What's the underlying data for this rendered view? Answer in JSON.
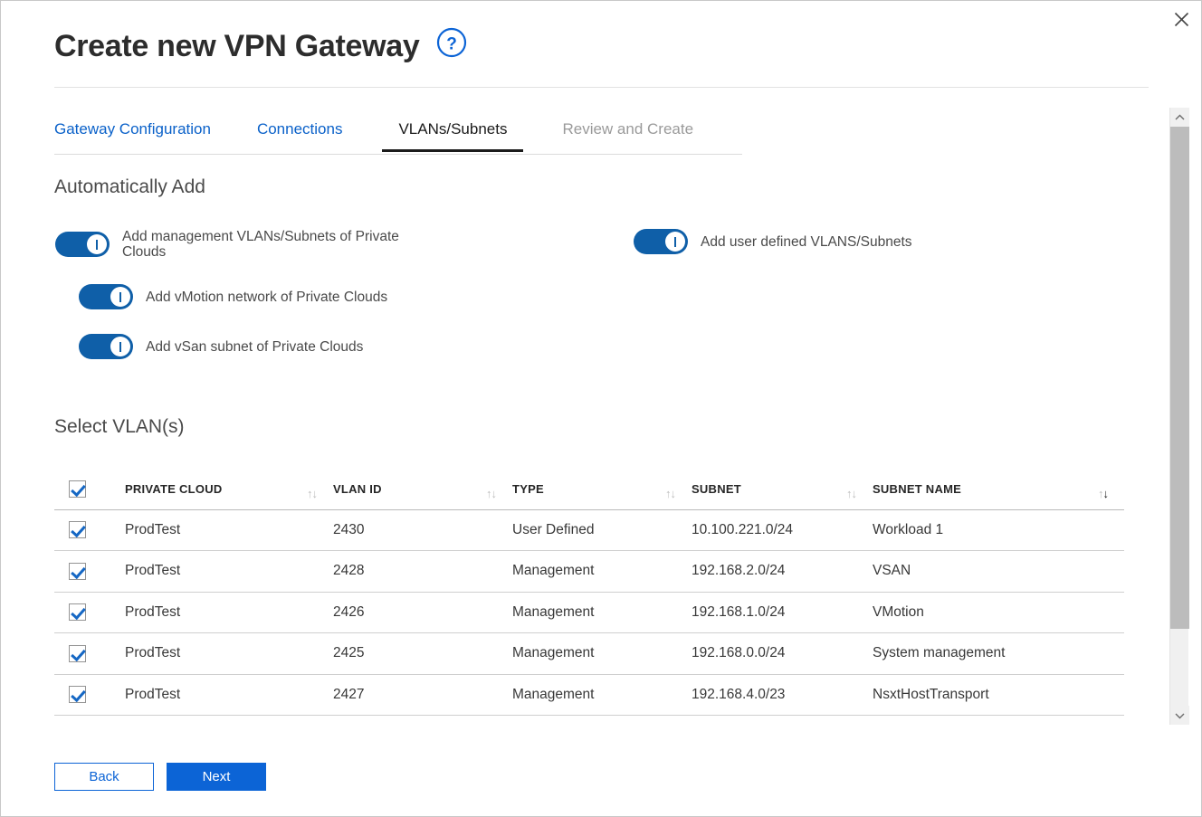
{
  "window": {
    "title": "Create new VPN Gateway",
    "close_icon": "close-icon",
    "help_icon": "help-circle-icon"
  },
  "tabs": [
    {
      "label": "Gateway Configuration",
      "state": "link"
    },
    {
      "label": "Connections",
      "state": "link"
    },
    {
      "label": "VLANs/Subnets",
      "state": "active"
    },
    {
      "label": "Review and Create",
      "state": "disabled"
    }
  ],
  "sections": {
    "automatically_add": "Automatically Add",
    "select_vlans": "Select VLAN(s)"
  },
  "toggles": [
    {
      "id": "add-management-vlans",
      "label": "Add management VLANs/Subnets of Private Clouds",
      "on": true
    },
    {
      "id": "add-user-defined-vlans",
      "label": "Add user defined VLANS/Subnets",
      "on": true
    },
    {
      "id": "add-vmotion-network",
      "label": "Add vMotion network of Private Clouds",
      "on": true
    },
    {
      "id": "add-vsan-subnet",
      "label": "Add vSan subnet of Private Clouds",
      "on": true
    }
  ],
  "table": {
    "columns": [
      {
        "label": "PRIVATE CLOUD",
        "sortable": true,
        "sort": "none"
      },
      {
        "label": "VLAN ID",
        "sortable": true,
        "sort": "none"
      },
      {
        "label": "TYPE",
        "sortable": true,
        "sort": "none"
      },
      {
        "label": "SUBNET",
        "sortable": true,
        "sort": "none"
      },
      {
        "label": "SUBNET NAME",
        "sortable": true,
        "sort": "desc"
      }
    ],
    "select_all_checked": true,
    "rows": [
      {
        "checked": true,
        "private_cloud": "ProdTest",
        "vlan_id": "2430",
        "type": "User Defined",
        "subnet": "10.100.221.0/24",
        "subnet_name": "Workload 1"
      },
      {
        "checked": true,
        "private_cloud": "ProdTest",
        "vlan_id": "2428",
        "type": "Management",
        "subnet": "192.168.2.0/24",
        "subnet_name": "VSAN"
      },
      {
        "checked": true,
        "private_cloud": "ProdTest",
        "vlan_id": "2426",
        "type": "Management",
        "subnet": "192.168.1.0/24",
        "subnet_name": "VMotion"
      },
      {
        "checked": true,
        "private_cloud": "ProdTest",
        "vlan_id": "2425",
        "type": "Management",
        "subnet": "192.168.0.0/24",
        "subnet_name": "System management"
      },
      {
        "checked": true,
        "private_cloud": "ProdTest",
        "vlan_id": "2427",
        "type": "Management",
        "subnet": "192.168.4.0/23",
        "subnet_name": "NsxtHostTransport"
      }
    ]
  },
  "footer": {
    "back_label": "Back",
    "next_label": "Next"
  },
  "scrollbar": {
    "up_icon": "chevron-up-icon",
    "down_icon": "chevron-down-icon"
  },
  "colors": {
    "link_blue": "#0a61c9",
    "primary_blue": "#0c64d6",
    "toggle_blue": "#0f5fa8",
    "checkbox_blue": "#1567c4",
    "text_dark": "#2d2d2d",
    "text_muted": "#9a9a9a"
  }
}
